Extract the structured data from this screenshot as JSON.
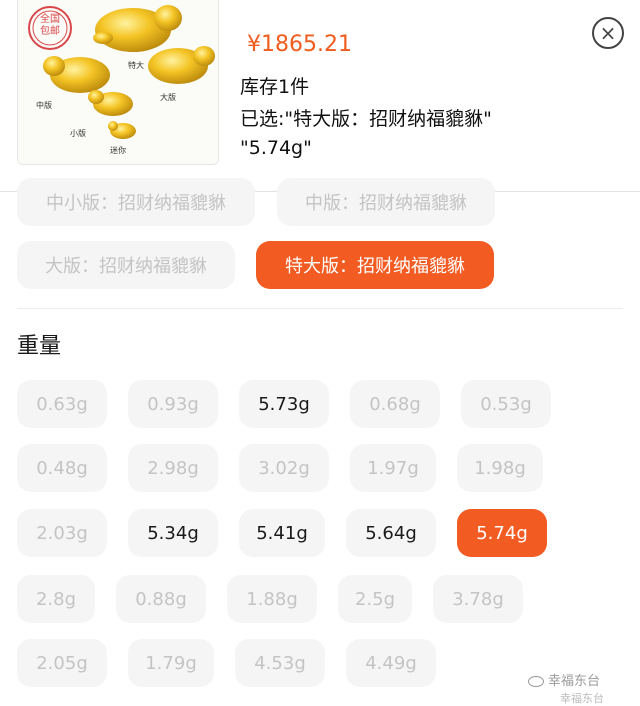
{
  "product": {
    "price": "¥1865.21",
    "stock": "库存1件",
    "selected_line1": "已选:\"特大版：招财纳福貔貅\"",
    "selected_line2": "\"5.74g\"",
    "image_stamp_text": "全国包邮",
    "image_labels": [
      "特大",
      "大版",
      "中版",
      "小版",
      "迷你"
    ]
  },
  "close_icon": "×",
  "style_options": [
    {
      "label": "中小版：招财纳福貔貅",
      "state": "disabled"
    },
    {
      "label": "中版：招财纳福貔貅",
      "state": "disabled"
    },
    {
      "label": "大版：招财纳福貔貅",
      "state": "disabled"
    },
    {
      "label": "特大版：招财纳福貔貅",
      "state": "selected"
    }
  ],
  "weight_section": {
    "title": "重量",
    "options": [
      {
        "label": "0.63g",
        "state": "disabled"
      },
      {
        "label": "0.93g",
        "state": "disabled"
      },
      {
        "label": "5.73g",
        "state": "available"
      },
      {
        "label": "0.68g",
        "state": "disabled"
      },
      {
        "label": "0.53g",
        "state": "disabled"
      },
      {
        "label": "0.48g",
        "state": "disabled"
      },
      {
        "label": "2.98g",
        "state": "disabled"
      },
      {
        "label": "3.02g",
        "state": "disabled"
      },
      {
        "label": "1.97g",
        "state": "disabled"
      },
      {
        "label": "1.98g",
        "state": "disabled"
      },
      {
        "label": "2.03g",
        "state": "disabled"
      },
      {
        "label": "5.34g",
        "state": "available"
      },
      {
        "label": "5.41g",
        "state": "available"
      },
      {
        "label": "5.64g",
        "state": "available"
      },
      {
        "label": "5.74g",
        "state": "selected"
      },
      {
        "label": "2.8g",
        "state": "disabled"
      },
      {
        "label": "0.88g",
        "state": "disabled"
      },
      {
        "label": "1.88g",
        "state": "disabled"
      },
      {
        "label": "2.5g",
        "state": "disabled"
      },
      {
        "label": "3.78g",
        "state": "disabled"
      },
      {
        "label": "2.05g",
        "state": "disabled"
      },
      {
        "label": "1.79g",
        "state": "disabled"
      },
      {
        "label": "4.53g",
        "state": "disabled"
      },
      {
        "label": "4.49g",
        "state": "disabled"
      }
    ]
  },
  "watermark": {
    "line1": "幸福东台",
    "line2": "幸福东台"
  },
  "colors": {
    "accent": "#f25b22",
    "price": "#f05b1e",
    "chip_bg": "#f5f5f5",
    "disabled_text": "#c4c4c4"
  }
}
